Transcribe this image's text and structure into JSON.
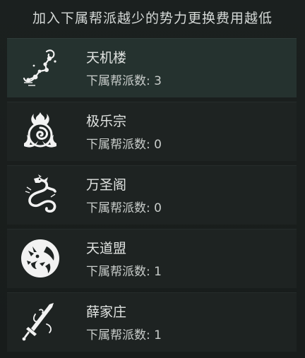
{
  "header": {
    "text": "加入下属帮派越少的势力更换费用越低"
  },
  "factions": [
    {
      "name": "天机楼",
      "count_label": "下属帮派数: 3",
      "icon": "constellation-emblem-icon",
      "selected": true
    },
    {
      "name": "极乐宗",
      "count_label": "下属帮派数: 0",
      "icon": "flame-swirl-emblem-icon",
      "selected": false
    },
    {
      "name": "万圣阁",
      "count_label": "下属帮派数: 0",
      "icon": "dragon-emblem-icon",
      "selected": false
    },
    {
      "name": "天道盟",
      "count_label": "下属帮派数: 1",
      "icon": "beast-head-emblem-icon",
      "selected": false
    },
    {
      "name": "薛家庄",
      "count_label": "下属帮派数: 1",
      "icon": "sword-emblem-icon",
      "selected": false
    }
  ],
  "colors": {
    "background": "#171b1a",
    "row": "#1e2322",
    "row_selected": "#25322f",
    "text": "#e0e3e1",
    "emblem": "#f2f2f2"
  }
}
